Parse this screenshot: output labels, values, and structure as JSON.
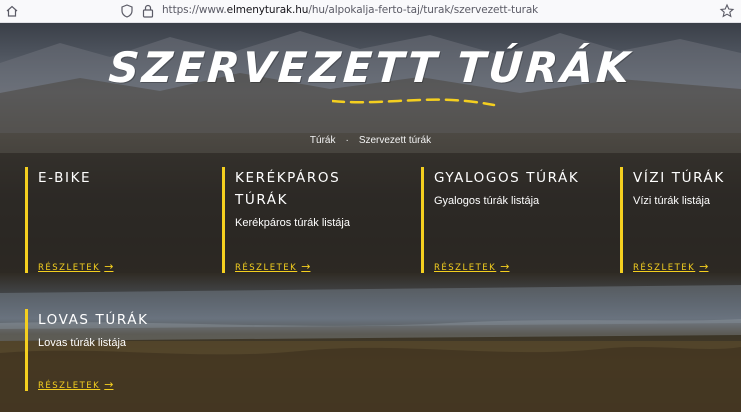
{
  "browser": {
    "url_prefix": "https://www.",
    "url_domain": "elmenyturak.hu",
    "url_path": "/hu/alpokalja-ferto-taj/turak/szervezett-turak"
  },
  "page": {
    "title": "SZERVEZETT TÚRÁK",
    "breadcrumb": [
      "Túrák",
      "·",
      "Szervezett túrák"
    ],
    "accent_color": "#f4cf1f"
  },
  "cards": [
    {
      "title": "E-BIKE",
      "desc": "",
      "more": "RÉSZLETEK",
      "arrow": "→"
    },
    {
      "title": "KERÉKPÁROS TÚRÁK",
      "desc": "Kerékpáros túrák listája",
      "more": "RÉSZLETEK",
      "arrow": "→"
    },
    {
      "title": "GYALOGOS TÚRÁK",
      "desc": "Gyalogos túrák listája",
      "more": "RÉSZLETEK",
      "arrow": "→"
    },
    {
      "title": "VÍZI TÚRÁK",
      "desc": "Vízi túrák listája",
      "more": "RÉSZLETEK",
      "arrow": "→"
    },
    {
      "title": "LOVAS TÚRÁK",
      "desc": "Lovas túrák listája",
      "more": "RÉSZLETEK",
      "arrow": "→"
    }
  ]
}
